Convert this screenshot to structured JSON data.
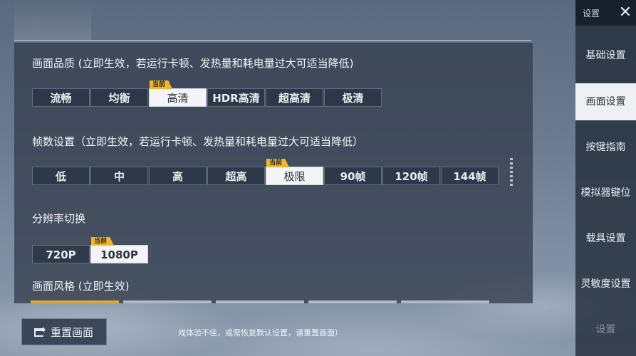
{
  "sidebar": {
    "title": "设置",
    "items": [
      {
        "label": "基础设置"
      },
      {
        "label": "画面设置"
      },
      {
        "label": "按键指南"
      },
      {
        "label": "模拟器键位"
      },
      {
        "label": "载具设置"
      },
      {
        "label": "灵敏度设置"
      },
      {
        "label": "设置"
      }
    ],
    "active_index": 1
  },
  "badge_label": "当前",
  "graphics_quality": {
    "title": "画面品质 (立即生效，若运行卡顿、发热量和耗电量过大可适当降低)",
    "options": [
      "流畅",
      "均衡",
      "高清",
      "HDR高清",
      "超高清",
      "极清"
    ],
    "selected": "高清"
  },
  "frame_rate": {
    "title": "帧数设置（立即生效，若运行卡顿、发热量和耗电量过大可适当降低）",
    "options": [
      "低",
      "中",
      "高",
      "超高",
      "极限",
      "90帧",
      "120帧",
      "144帧"
    ],
    "selected": "极限"
  },
  "resolution": {
    "title": "分辨率切换",
    "options": [
      "720P",
      "1080P"
    ],
    "selected": "1080P"
  },
  "graphics_style": {
    "title": "画面风格 (立即生效)"
  },
  "footer": {
    "reset_label": "重置画面",
    "hint": "戏体验不佳，或需恢复默认设置，请重置画面）"
  },
  "colors": {
    "accent_badge": "#f0b72c",
    "active_option_bg": "#f3f4f6",
    "panel_bg": "#343e4e"
  }
}
